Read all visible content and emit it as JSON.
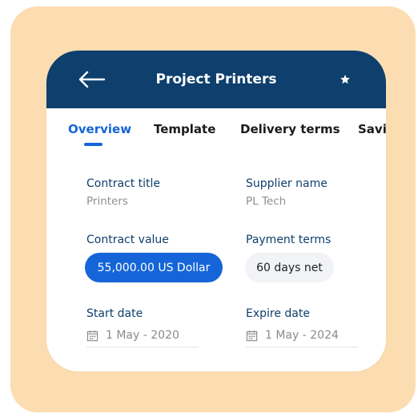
{
  "header": {
    "title": "Project Printers",
    "back_icon": "arrow-left-icon",
    "favorite_icon": "star-icon"
  },
  "tabs": [
    {
      "label": "Overview",
      "active": true
    },
    {
      "label": "Template",
      "active": false
    },
    {
      "label": "Delivery terms",
      "active": false
    },
    {
      "label": "Savi",
      "active": false
    }
  ],
  "fields": {
    "contract_title": {
      "label": "Contract title",
      "value": "Printers"
    },
    "supplier_name": {
      "label": "Supplier name",
      "value": "PL Tech"
    },
    "contract_value": {
      "label": "Contract value",
      "value": "55,000.00 US Dollar"
    },
    "payment_terms": {
      "label": "Payment terms",
      "value": "60 days net"
    },
    "start_date": {
      "label": "Start date",
      "value": "1 May - 2020"
    },
    "expire_date": {
      "label": "Expire date",
      "value": "1 May - 2024"
    }
  },
  "colors": {
    "header_bg": "#0E3F6D",
    "accent": "#1565D8",
    "background_card": "#FCDDB1"
  }
}
